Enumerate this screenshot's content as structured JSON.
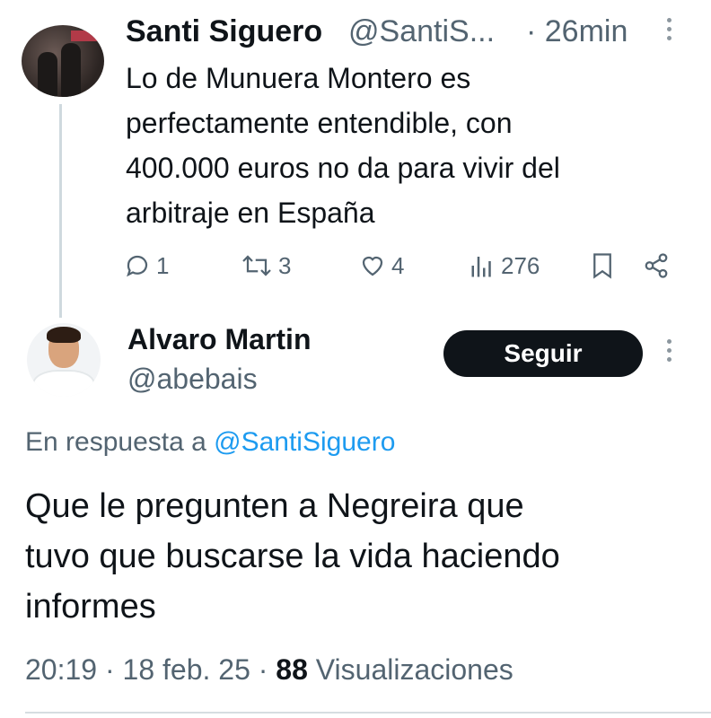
{
  "parent_tweet": {
    "author_name": "Santi Siguero",
    "author_handle": "@SantiS...",
    "separator_time": "· 26min",
    "text": "Lo de Munuera Montero es\nperfectamente entendible, con\n400.000 euros no da para vivir del\narbitraje en España",
    "actions": {
      "replies": "1",
      "retweets": "3",
      "likes": "4",
      "views": "276"
    }
  },
  "reply_tweet": {
    "author_name": "Alvaro Martin",
    "author_handle": "@abebais",
    "follow_label": "Seguir",
    "reply_prefix": "En respuesta a ",
    "reply_mention": "@SantiSiguero",
    "text": "Que le pregunten a Negreira que\ntuvo que buscarse la vida haciendo\ninformes",
    "time": "20:19",
    "date": "18 feb. 25",
    "views_count": "88",
    "views_label": "Visualizaciones"
  },
  "icons": [
    "reply-icon",
    "retweet-icon",
    "like-icon",
    "views-icon",
    "bookmark-icon",
    "share-icon",
    "more-icon"
  ],
  "colors": {
    "text": "#0f1419",
    "secondary": "#536471",
    "link": "#1d9bf0",
    "button": "#0f1419"
  }
}
